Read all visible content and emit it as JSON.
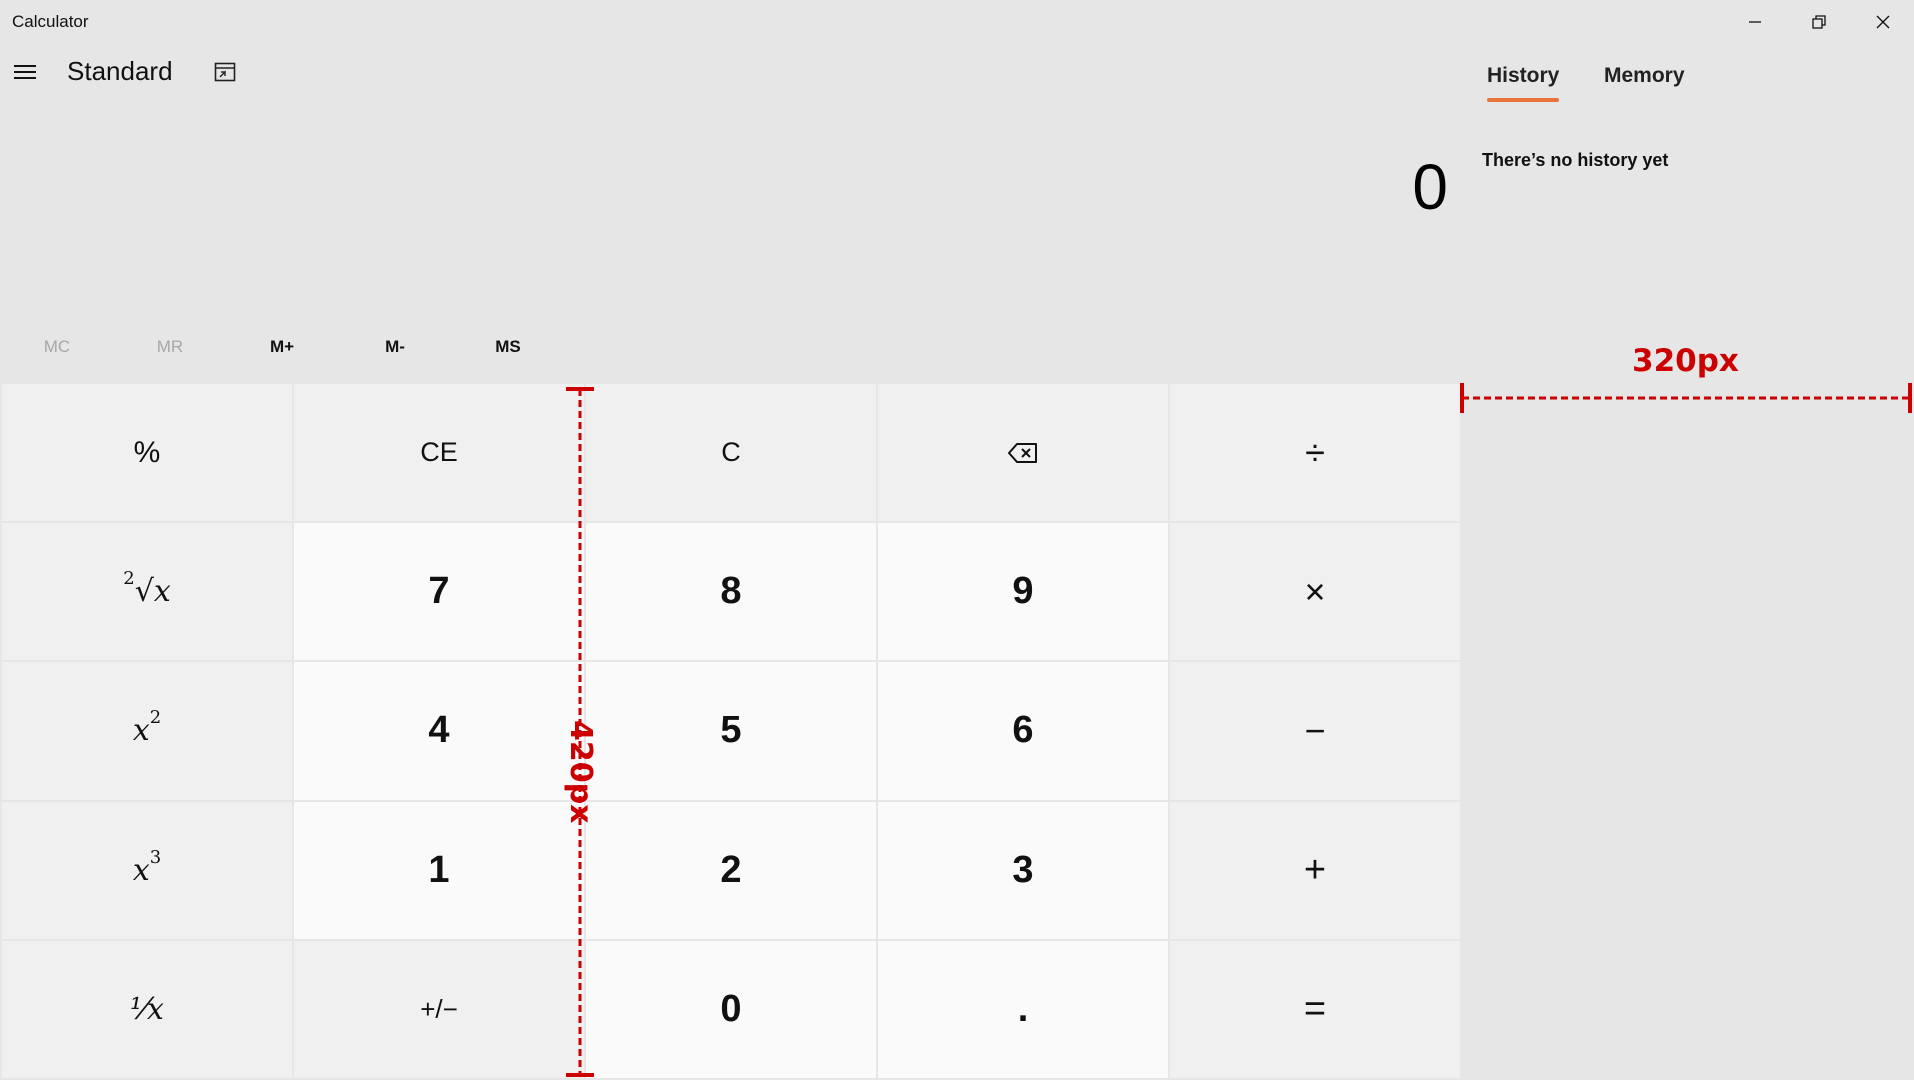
{
  "window": {
    "title": "Calculator",
    "controls": [
      "minimize-icon",
      "restore-icon",
      "close-icon"
    ]
  },
  "header": {
    "mode": "Standard",
    "menu_icon": "hamburger-icon",
    "keep_on_top_icon": "keep-on-top-icon"
  },
  "display": {
    "value": "0"
  },
  "memory": {
    "buttons": [
      {
        "label": "MC",
        "enabled": false
      },
      {
        "label": "MR",
        "enabled": false
      },
      {
        "label": "M+",
        "enabled": true
      },
      {
        "label": "M-",
        "enabled": true
      },
      {
        "label": "MS",
        "enabled": true
      }
    ]
  },
  "keypad": {
    "row1": {
      "percent": "%",
      "ce": "CE",
      "c": "C",
      "backspace_icon": "backspace-icon",
      "divide": "÷"
    },
    "row2": {
      "seven": "7",
      "eight": "8",
      "nine": "9",
      "multiply": "×"
    },
    "row3": {
      "four": "4",
      "five": "5",
      "six": "6",
      "minus": "−"
    },
    "row4": {
      "one": "1",
      "two": "2",
      "three": "3",
      "plus": "+"
    },
    "row5": {
      "negate": "+/−",
      "zero": "0",
      "decimal": ".",
      "equals": "="
    },
    "functions": {
      "sqrt_root_index": "2",
      "sqrt_x": "x",
      "square_x": "x",
      "square_exp": "2",
      "cube_x": "x",
      "cube_exp": "3",
      "reciprocal": "⅟x"
    }
  },
  "side_panel": {
    "tabs": [
      {
        "label": "History",
        "active": true
      },
      {
        "label": "Memory",
        "active": false
      }
    ],
    "empty_message": "There’s no history yet"
  },
  "annotations": {
    "horizontal_label": "320px",
    "vertical_label": "420px",
    "color": "#cc0000"
  },
  "colors": {
    "background": "#e6e6e6",
    "number_key": "#fafafa",
    "operator_key": "#f0f0f0",
    "accent": "#e8743b"
  }
}
